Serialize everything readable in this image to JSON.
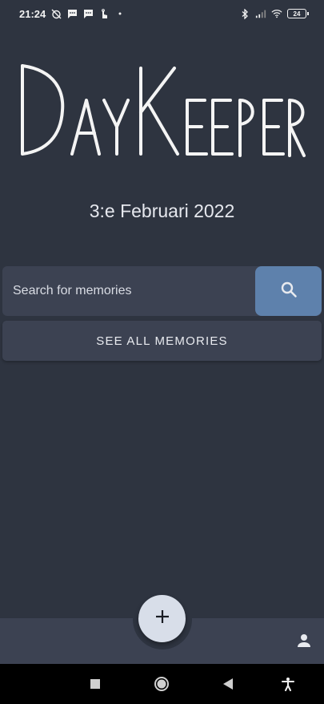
{
  "status_bar": {
    "time": "21:24",
    "battery": "24",
    "icons": [
      "alarm-off-icon",
      "message-icon",
      "message-icon",
      "hand-icon",
      "dot-icon",
      "bluetooth-icon",
      "signal-icon",
      "wifi-icon",
      "battery-icon"
    ]
  },
  "app": {
    "logo_text": "DayKeeper",
    "date": "3:e Februari 2022"
  },
  "search": {
    "placeholder": "Search for memories",
    "button_icon": "search-icon"
  },
  "see_all_label": "SEE ALL MEMORIES",
  "bottom_bar": {
    "fab_icon": "plus-icon",
    "profile_icon": "person-icon"
  },
  "nav_bar": {
    "icons": [
      "recents-icon",
      "home-icon",
      "back-icon",
      "accessibility-icon"
    ]
  },
  "colors": {
    "background": "#2e3440",
    "surface": "#3c4252",
    "accent": "#5e81ac",
    "fab": "#d8dee9"
  }
}
